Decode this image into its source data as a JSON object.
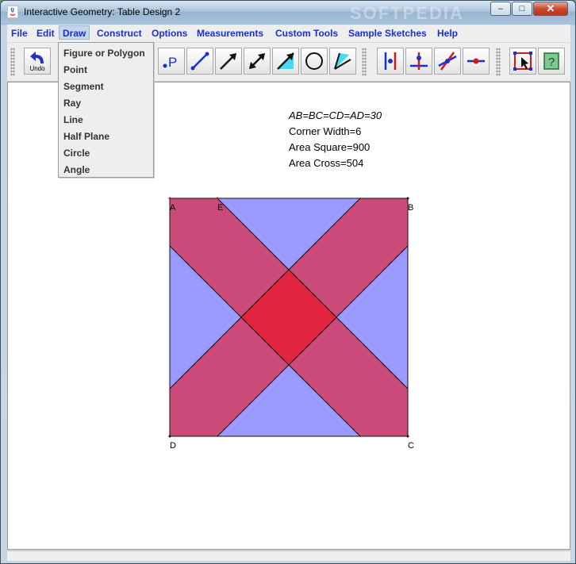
{
  "window": {
    "title": "Interactive Geometry: Table Design 2",
    "minimize_label": "–",
    "maximize_label": "□",
    "close_label": "✕",
    "watermark": "SOFTPEDIA"
  },
  "menubar": {
    "items": [
      "File",
      "Edit",
      "Draw",
      "Construct",
      "Options",
      "Measurements",
      "Custom Tools",
      "Sample Sketches",
      "Help"
    ]
  },
  "toolbar": {
    "undo_label": "Undo",
    "point_label": "P",
    "tools": [
      "undo-icon",
      "point-icon",
      "segment-icon",
      "ray-icon",
      "line-icon",
      "half-plane-icon",
      "circle-icon",
      "angle-icon",
      "perpendicular-icon",
      "parallel-icon",
      "intersection-icon",
      "midpoint-icon",
      "select-icon",
      "help-icon"
    ],
    "help_label": "?"
  },
  "draw_menu": {
    "items": [
      "Figure or Polygon",
      "Point",
      "Segment",
      "Ray",
      "Line",
      "Half Plane",
      "Circle",
      "Angle"
    ]
  },
  "measurements": {
    "sides": "AB=BC=CD=AD=30",
    "corner_width": "Corner Width=6",
    "area_square": "Area Square=900",
    "area_cross": "Area Cross=504"
  },
  "points": {
    "A": "A",
    "E": "E",
    "B": "B",
    "C": "C",
    "D": "D"
  },
  "colors": {
    "square_fill": "#9999ff",
    "band_fill": "#cc4a7a",
    "center_fill": "#e3243f",
    "menu_text": "#1a2fd0"
  }
}
